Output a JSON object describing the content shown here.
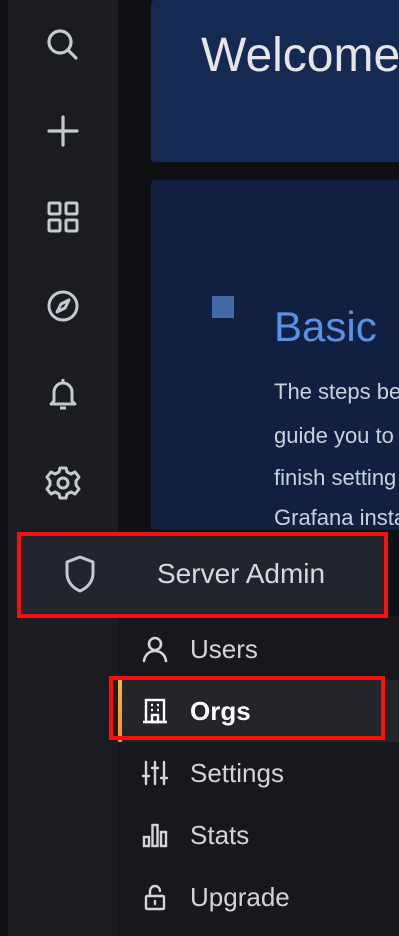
{
  "welcome": {
    "title": "Welcome to Grafana"
  },
  "setup": {
    "title": "Basic",
    "lines": [
      "The steps below will",
      "guide you to quickly",
      "finish setting up your",
      "Grafana installation."
    ]
  },
  "sidebar": {
    "icons": [
      "search-icon",
      "plus-icon",
      "dashboards-icon",
      "explore-icon",
      "alerting-icon",
      "configuration-icon"
    ]
  },
  "server_admin": {
    "title": "Server Admin",
    "icon": "shield-icon",
    "items": [
      {
        "label": "Users",
        "icon": "user-icon"
      },
      {
        "label": "Orgs",
        "icon": "building-icon",
        "active": true
      },
      {
        "label": "Settings",
        "icon": "sliders-icon"
      },
      {
        "label": "Stats",
        "icon": "bar-chart-icon"
      },
      {
        "label": "Upgrade",
        "icon": "unlock-icon"
      }
    ]
  },
  "colors": {
    "highlight": "#ff0d0d",
    "accent_gradient_start": "#f5b73b",
    "accent_gradient_end": "#ff8833"
  }
}
